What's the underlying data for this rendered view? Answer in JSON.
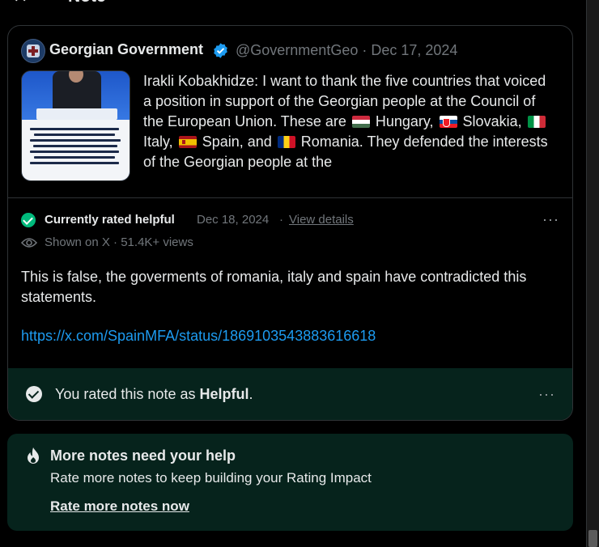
{
  "header": {
    "title": "Note",
    "close_icon": "close-icon"
  },
  "tweet": {
    "author_name": "Georgian Government",
    "verified": true,
    "handle": "@GovernmentGeo",
    "date": "Dec 17, 2024",
    "text_part1": "Irakli Kobakhidze: I want to thank the five countries that voiced a position in support of the Georgian people at the Council of the European Union. These are ",
    "country1": " Hungary, ",
    "country2": " Slovakia, ",
    "country3": " Italy, ",
    "country4": " Spain, and ",
    "country5": " Romania. They defended the interests of the Georgian people at the",
    "flags": [
      "hungary-flag-icon",
      "slovakia-flag-icon",
      "italy-flag-icon",
      "spain-flag-icon",
      "romania-flag-icon"
    ]
  },
  "note": {
    "status_label": "Currently rated helpful",
    "status_date": "Dec 18, 2024",
    "separator": "·",
    "view_details": "View details",
    "shown_text": "Shown on X · 51.4K+ views",
    "body": "This is false, the goverments of romania, italy and spain have contradicted this statements.",
    "link": "https://x.com/SpainMFA/status/1869103543883616618",
    "status_color": "#00ba7c",
    "link_color": "#1d9bf0"
  },
  "rating": {
    "prefix": "You rated this note as ",
    "value": "Helpful",
    "suffix": "."
  },
  "help": {
    "title": "More notes need your help",
    "subtitle": "Rate more notes to keep building your Rating Impact",
    "link": "Rate more notes now"
  },
  "colors": {
    "background": "#000000",
    "panel_green": "#06231c",
    "border": "#2f3336"
  }
}
